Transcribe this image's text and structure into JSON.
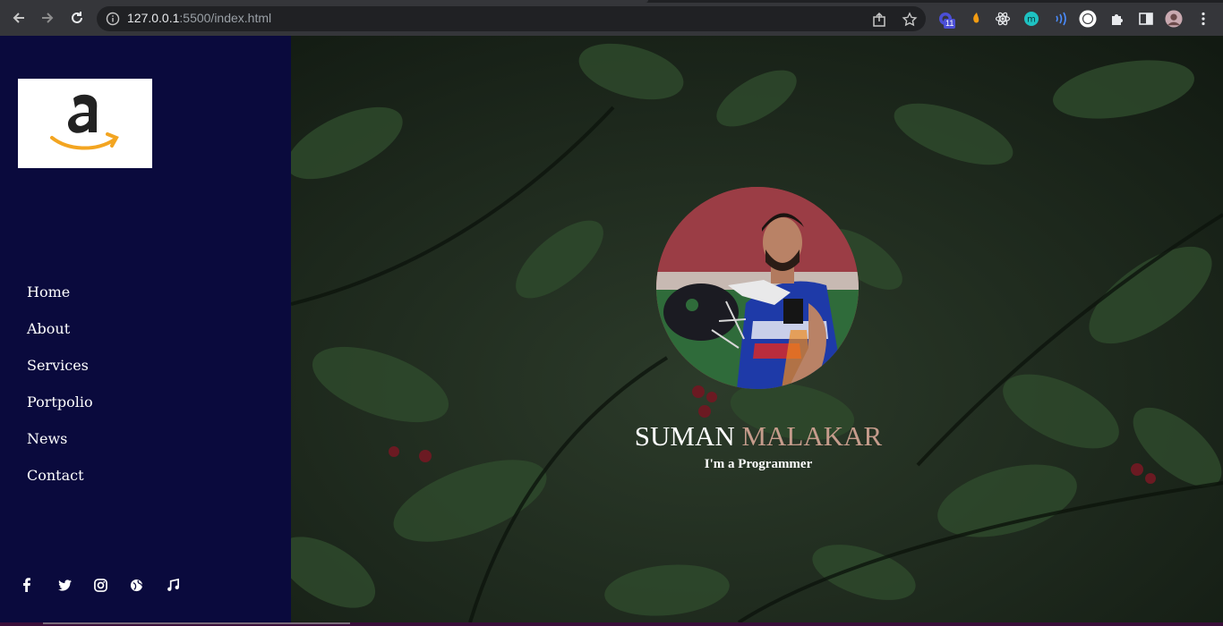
{
  "browser": {
    "url_host": "127.0.0.1",
    "url_rest": ":5500/index.html",
    "extension_badge": "11"
  },
  "sidebar": {
    "logo": "amazon-logo",
    "nav": [
      {
        "label": "Home"
      },
      {
        "label": "About"
      },
      {
        "label": "Services"
      },
      {
        "label": "Portpolio"
      },
      {
        "label": "News"
      },
      {
        "label": "Contact"
      }
    ],
    "social": [
      "facebook-icon",
      "twitter-icon",
      "instagram-icon",
      "globe-icon",
      "music-icon"
    ]
  },
  "hero": {
    "first_name": "SUMAN",
    "last_name": "MALAKAR",
    "tagline": "I'm a Programmer"
  },
  "colors": {
    "sidebar_bg": "#0a0a3d",
    "accent_name": "#c69c8c",
    "amazon_orange": "#f3a521"
  }
}
